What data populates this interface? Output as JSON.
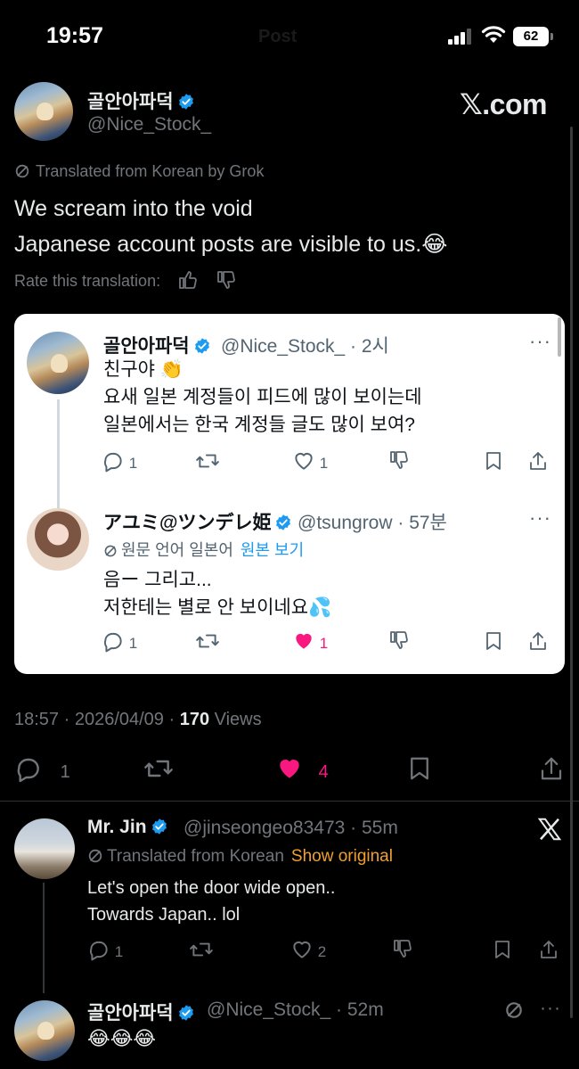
{
  "status_bar": {
    "time": "19:57",
    "ghost_title": "Post",
    "battery": "62"
  },
  "author": {
    "display_name": "골안아파덕",
    "handle": "@Nice_Stock_",
    "watermark": "𝕏.com"
  },
  "post": {
    "translated_label": "Translated from Korean by Grok",
    "text_lines": [
      "We scream into the void",
      "Japanese account posts are visible to us.😂"
    ],
    "rate_label": "Rate this translation:",
    "timestamp": "18:57 · 2026/04/09 · ",
    "views_count": "170",
    "views_label": " Views",
    "reply_count": "1",
    "like_count": "4",
    "like_color": "#f91880"
  },
  "quote": {
    "tweet1": {
      "display_name": "골안아파덕",
      "handle_time": "@Nice_Stock_ · 2시",
      "lines": [
        "친구야 👏",
        "요새 일본 계정들이 피드에 많이 보이는데",
        "일본에서는 한국 계정들 글도 많이 보여?"
      ],
      "reply_count": "1",
      "like_count": "1",
      "more": "···"
    },
    "tweet2": {
      "display_name": "アユミ@ツンデレ姫",
      "handle_time": "@tsungrow · 57분",
      "translated_label": "원문 언어 일본어",
      "translated_link": "원본 보기",
      "lines": [
        "음ー 그리고...",
        "저한테는 별로 안 보이네요💦"
      ],
      "reply_count": "1",
      "like_count": "1",
      "more": "···"
    }
  },
  "replies": [
    {
      "display_name": "Mr. Jin",
      "handle_time": "@jinseongeo83473 · 55m",
      "translated_label": "Translated from Korean",
      "translated_link": "Show original",
      "lines": [
        "Let's open the door wide open..",
        "Towards Japan.. lol"
      ],
      "reply_count": "1",
      "like_count": "2"
    },
    {
      "display_name": "골안아파덕",
      "handle_time": "@Nice_Stock_ · 52m",
      "text": "😂😂😂",
      "more": "···"
    }
  ]
}
